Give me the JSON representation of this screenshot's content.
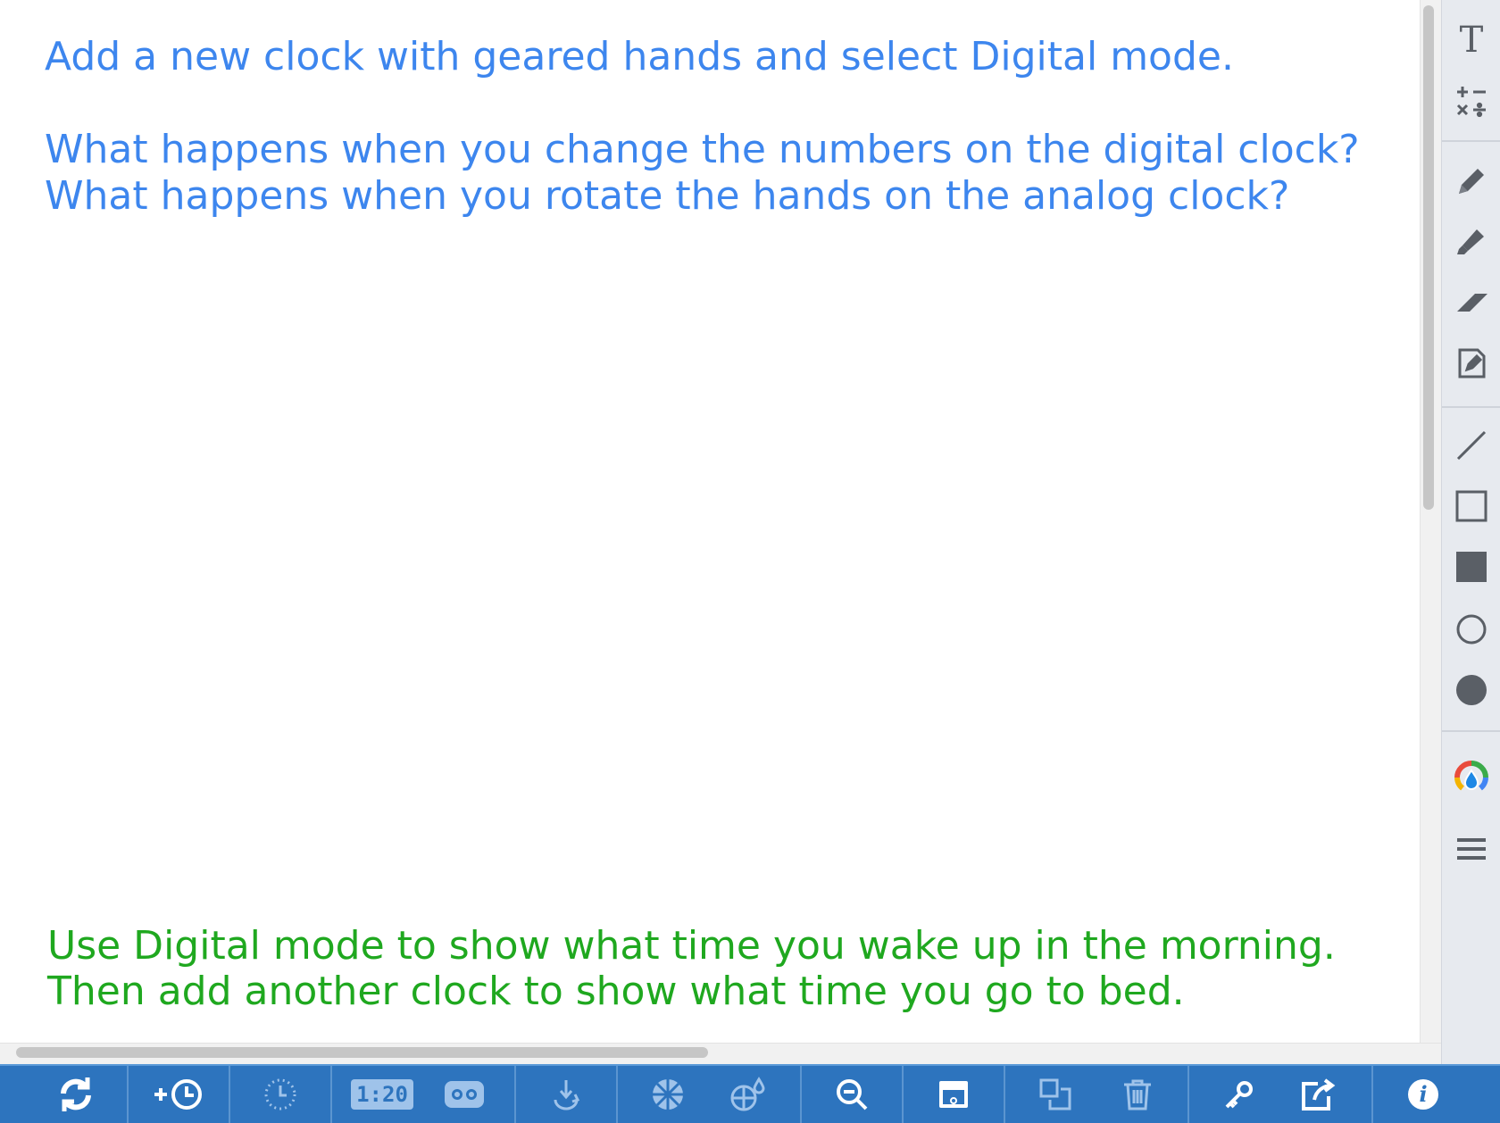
{
  "canvas": {
    "prompt_line1": "Add a new clock with geared hands and select Digital mode.",
    "prompt_line2": "What happens when you change the numbers on the digital clock?",
    "prompt_line3": "What happens when you rotate the hands on the analog clock?",
    "hint_line1": "Use Digital mode to show what time you wake up in the morning.",
    "hint_line2": "Then add another clock to show what time you go to bed."
  },
  "colors": {
    "prompt_text": "#3d86ee",
    "hint_text": "#1fa81f",
    "toolbar_bg": "#2d74be",
    "sidebar_bg": "#e7eaef",
    "sidebar_icon": "#5a5f66"
  },
  "sidebar_tools": [
    {
      "name": "text-tool",
      "icon": "text-T-icon"
    },
    {
      "name": "math-tool",
      "icon": "math-operators-icon"
    },
    {
      "name": "pen-tool",
      "icon": "pencil-icon"
    },
    {
      "name": "highlighter-tool",
      "icon": "highlighter-icon"
    },
    {
      "name": "eraser-tool",
      "icon": "eraser-icon"
    },
    {
      "name": "note-tool",
      "icon": "note-edit-icon"
    },
    {
      "name": "line-tool",
      "icon": "line-icon"
    },
    {
      "name": "rectangle-tool",
      "icon": "rectangle-outline-icon"
    },
    {
      "name": "filled-rectangle-tool",
      "icon": "rectangle-filled-icon"
    },
    {
      "name": "circle-tool",
      "icon": "circle-outline-icon"
    },
    {
      "name": "filled-circle-tool",
      "icon": "circle-filled-icon"
    },
    {
      "name": "color-tool",
      "icon": "color-palette-drop-icon"
    },
    {
      "name": "line-weight-tool",
      "icon": "line-weight-icon"
    }
  ],
  "bottom_toolbar": {
    "digital_display": "1:20",
    "buttons": [
      {
        "name": "refresh",
        "icon": "refresh-icon"
      },
      {
        "name": "add-clock",
        "icon": "add-clock-icon"
      },
      {
        "name": "clock-face",
        "icon": "dotted-clock-icon"
      },
      {
        "name": "digital-mode",
        "icon": "digital-clock-icon"
      },
      {
        "name": "geared-hands",
        "icon": "gears-icon"
      },
      {
        "name": "rotate-hands",
        "icon": "rotate-hand-icon"
      },
      {
        "name": "fraction-wheel",
        "icon": "pie-wheel-icon"
      },
      {
        "name": "color-sections",
        "icon": "pie-color-icon"
      },
      {
        "name": "zoom-out",
        "icon": "zoom-out-icon"
      },
      {
        "name": "cover",
        "icon": "window-shade-icon"
      },
      {
        "name": "duplicate",
        "icon": "duplicate-icon"
      },
      {
        "name": "delete",
        "icon": "trash-icon"
      },
      {
        "name": "key",
        "icon": "key-icon"
      },
      {
        "name": "share",
        "icon": "share-icon"
      },
      {
        "name": "info",
        "icon": "info-icon"
      }
    ]
  }
}
